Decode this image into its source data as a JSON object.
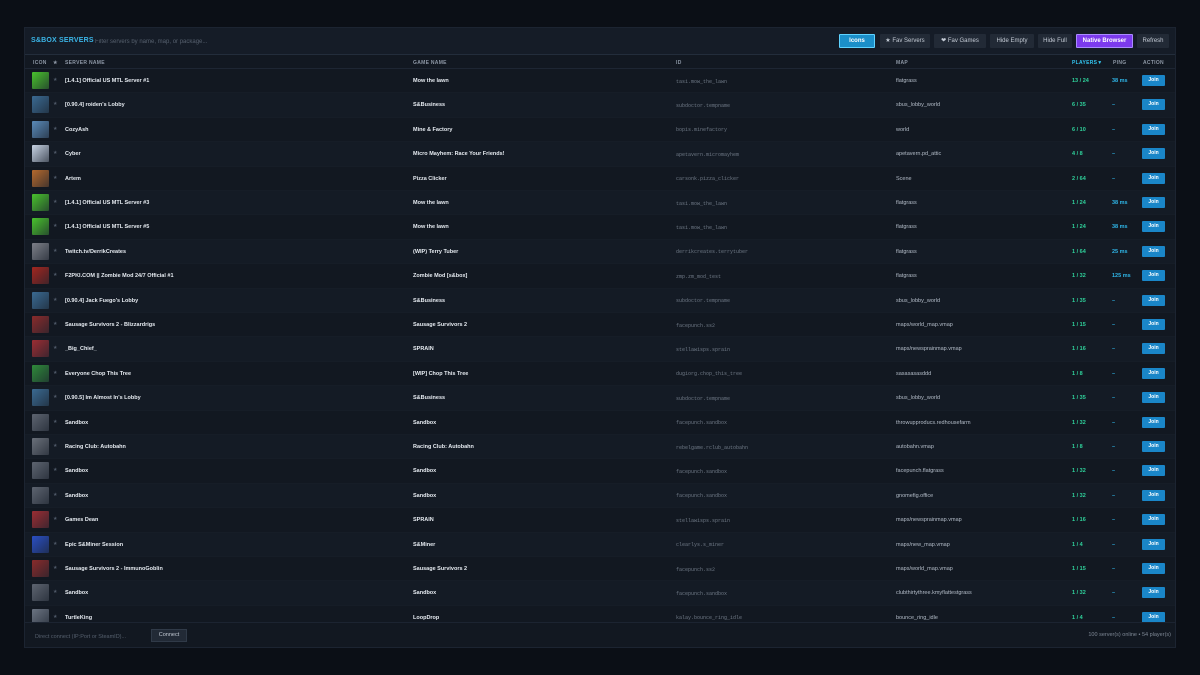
{
  "app": {
    "title": "S&BOX SERVERS"
  },
  "search": {
    "placeholder": "Filter servers by name, map, or package..."
  },
  "toolbar": {
    "icons_label": "Icons",
    "fav_servers_label": "★ Fav Servers",
    "fav_games_label": "❤ Fav Games",
    "hide_empty_label": "Hide Empty",
    "hide_full_label": "Hide Full",
    "native_browser_label": "Native Browser",
    "refresh_label": "Refresh"
  },
  "columns": {
    "icon": "ICON",
    "fav": "★",
    "server_name": "SERVER NAME",
    "game_name": "GAME NAME",
    "id": "ID",
    "map": "MAP",
    "players": "PLAYERS▼",
    "ping": "PING",
    "action": "ACTION"
  },
  "rows": [
    {
      "name": "[1.4.1] Official US MTL Server #1",
      "game": "Mow the lawn",
      "id": "tasi.mow_the_lawn",
      "map": "flatgrass",
      "players": "13 / 24",
      "ping": "38 ms",
      "thumb": "#49c22d",
      "icon": "mtl-icon"
    },
    {
      "name": "[0.90.4] roiden's Lobby",
      "game": "S&Business",
      "id": "subdoctor.tempname",
      "map": "sbus_lobby_world",
      "players": "6 / 35",
      "ping": "–",
      "thumb": "#3a6a92",
      "icon": "sbusiness-icon"
    },
    {
      "name": "CozyAsh",
      "game": "Mine & Factory",
      "id": "bopis.minefactory",
      "map": "world",
      "players": "6 / 10",
      "ping": "–",
      "thumb": "#5a8ab8",
      "icon": "mine-factory-icon"
    },
    {
      "name": "Cyber",
      "game": "Micro Mayhem: Race Your Friends!",
      "id": "apetavern.micromayhem",
      "map": "apetavern.pd_attic",
      "players": "4 / 8",
      "ping": "–",
      "thumb": "#c7d3e4",
      "icon": "micro-mayhem-icon"
    },
    {
      "name": "Artem",
      "game": "Pizza Clicker",
      "id": "carsonk.pizza_clicker",
      "map": "Scene",
      "players": "2 / 64",
      "ping": "–",
      "thumb": "#b5692d",
      "icon": "pizza-icon"
    },
    {
      "name": "[1.4.1] Official US MTL Server #3",
      "game": "Mow the lawn",
      "id": "tasi.mow_the_lawn",
      "map": "flatgrass",
      "players": "1 / 24",
      "ping": "38 ms",
      "thumb": "#49c22d",
      "icon": "mtl-icon"
    },
    {
      "name": "[1.4.1] Official US MTL Server #5",
      "game": "Mow the lawn",
      "id": "tasi.mow_the_lawn",
      "map": "flatgrass",
      "players": "1 / 24",
      "ping": "38 ms",
      "thumb": "#49c22d",
      "icon": "mtl-icon"
    },
    {
      "name": "Twitch.tv/DerrikCreates",
      "game": "(WIP) Terry Tuber",
      "id": "derrikcreates.terrytuber",
      "map": "flatgrass",
      "players": "1 / 64",
      "ping": "25 ms",
      "thumb": "#7c7f88",
      "icon": "terry-tuber-icon"
    },
    {
      "name": "F2PKI.COM || Zombie Mod 24/7 Official #1",
      "game": "Zombie Mod [s&box]",
      "id": "zmp.zm_mod_test",
      "map": "flatgrass",
      "players": "1 / 32",
      "ping": "125 ms",
      "thumb": "#a3261f",
      "icon": "zombie-mod-icon"
    },
    {
      "name": "[0.90.4] Jack Fuego's Lobby",
      "game": "S&Business",
      "id": "subdoctor.tempname",
      "map": "sbus_lobby_world",
      "players": "1 / 35",
      "ping": "–",
      "thumb": "#3a6a92",
      "icon": "sbusiness-icon"
    },
    {
      "name": "Sausage Survivors 2 - Blizzardrigs",
      "game": "Sausage Survivors 2",
      "id": "facepunch.ss2",
      "map": "maps/world_map.vmap",
      "players": "1 / 15",
      "ping": "–",
      "thumb": "#8a2b2b",
      "icon": "sausage-survivors-icon"
    },
    {
      "name": "_Big_Chief_",
      "game": "SPRAIN",
      "id": "stellawisps.sprain",
      "map": "maps/newsprainmap.vmap",
      "players": "1 / 16",
      "ping": "–",
      "thumb": "#9c2d33",
      "icon": "sprain-icon"
    },
    {
      "name": "Everyone Chop This Tree",
      "game": "[WIP] Chop This Tree",
      "id": "dugiorg.chop_this_tree",
      "map": "sasasasasddd",
      "players": "1 / 8",
      "ping": "–",
      "thumb": "#2f8a3a",
      "icon": "tree-icon"
    },
    {
      "name": "[0.90.5] Im Almost In's Lobby",
      "game": "S&Business",
      "id": "subdoctor.tempname",
      "map": "sbus_lobby_world",
      "players": "1 / 35",
      "ping": "–",
      "thumb": "#3a6a92",
      "icon": "sbusiness-icon"
    },
    {
      "name": "Sandbox",
      "game": "Sandbox",
      "id": "facepunch.sandbox",
      "map": "throwupproducs.redhousefarm",
      "players": "1 / 32",
      "ping": "–",
      "thumb": "#5d6470",
      "icon": "sandbox-icon"
    },
    {
      "name": "Racing Club: Autobahn",
      "game": "Racing Club: Autobahn",
      "id": "rebelgame.rclub_autobahn",
      "map": "autobahn.vmap",
      "players": "1 / 8",
      "ping": "–",
      "thumb": "#6a707a",
      "icon": "racing-club-icon"
    },
    {
      "name": "Sandbox",
      "game": "Sandbox",
      "id": "facepunch.sandbox",
      "map": "facepunch.flatgrass",
      "players": "1 / 32",
      "ping": "–",
      "thumb": "#5d6470",
      "icon": "sandbox-icon"
    },
    {
      "name": "Sandbox",
      "game": "Sandbox",
      "id": "facepunch.sandbox",
      "map": "gnomefig.office",
      "players": "1 / 32",
      "ping": "–",
      "thumb": "#5d6470",
      "icon": "sandbox-icon"
    },
    {
      "name": "Games Dean",
      "game": "SPRAIN",
      "id": "stellawisps.sprain",
      "map": "maps/newsprainmap.vmap",
      "players": "1 / 16",
      "ping": "–",
      "thumb": "#9c2d33",
      "icon": "sprain-icon"
    },
    {
      "name": "Epic S&Miner Session",
      "game": "S&Miner",
      "id": "clearlys.s_miner",
      "map": "maps/new_map.vmap",
      "players": "1 / 4",
      "ping": "–",
      "thumb": "#2a4fc4",
      "icon": "sminer-icon"
    },
    {
      "name": "Sausage Survivors 2 - ImmunoGoblin",
      "game": "Sausage Survivors 2",
      "id": "facepunch.ss2",
      "map": "maps/world_map.vmap",
      "players": "1 / 15",
      "ping": "–",
      "thumb": "#8a2b2b",
      "icon": "sausage-survivors-icon"
    },
    {
      "name": "Sandbox",
      "game": "Sandbox",
      "id": "facepunch.sandbox",
      "map": "clubthirtythree.kmyflattestgrass",
      "players": "1 / 32",
      "ping": "–",
      "thumb": "#5d6470",
      "icon": "sandbox-icon"
    },
    {
      "name": "TurtleKing",
      "game": "LoopDrop",
      "id": "kalay.bounce_ring_idle",
      "map": "bounce_ring_idle",
      "players": "1 / 4",
      "ping": "–",
      "thumb": "#6b7482",
      "icon": "loopdrop-icon"
    }
  ],
  "join_label": "Join",
  "footer": {
    "direct_placeholder": "Direct connect (IP:Port or SteamID)...",
    "connect_label": "Connect",
    "status": "100 server(s) online • 54 player(s)"
  }
}
